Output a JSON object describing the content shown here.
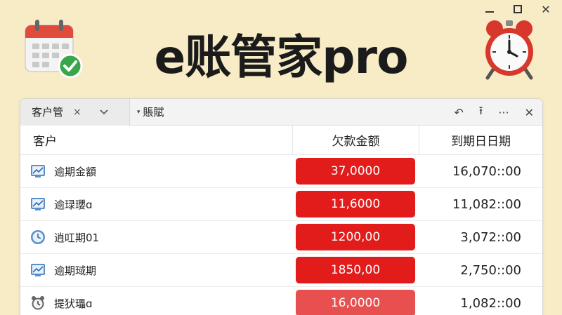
{
  "app": {
    "title": "e账管家pro"
  },
  "window_controls": {
    "minimize": "minimize",
    "maximize": "maximize",
    "close": "✕"
  },
  "tabs": [
    {
      "label": "客户管",
      "close": "×",
      "chevron": "⌄"
    },
    {
      "label": "賬賦",
      "caret": "▾"
    }
  ],
  "toolbar": {
    "back": "↶",
    "upload": "⭱",
    "more": "···",
    "close": "✕"
  },
  "table": {
    "headers": {
      "customer": "客户",
      "amount": "欠款金额",
      "due_date": "到期日日期"
    },
    "rows": [
      {
        "name": "逾期金額",
        "amount": "37,0000",
        "date": "16,070::00",
        "icon": "chart-icon",
        "badge_color": "#e21b1b"
      },
      {
        "name": "逾琭瓔ɑ",
        "amount": "11,6000",
        "date": "11,082::00",
        "icon": "chart-icon",
        "badge_color": "#e21b1b"
      },
      {
        "name": "逍叿期01",
        "amount": "1200,00",
        "date": "3,072::00",
        "icon": "clock-icon",
        "badge_color": "#e21b1b"
      },
      {
        "name": "逾期琙期",
        "amount": "1850,00",
        "date": "2,750::00",
        "icon": "chart-icon",
        "badge_color": "#e21b1b"
      },
      {
        "name": "提犾瓃ɑ",
        "amount": "16,0000",
        "date": "1,082::00",
        "icon": "alarm-icon",
        "badge_color": "#e85050"
      }
    ]
  },
  "colors": {
    "background": "#f7ecc6",
    "alert_red": "#e21b1b",
    "calendar_red": "#e14b3b",
    "check_green": "#3aa64a"
  }
}
